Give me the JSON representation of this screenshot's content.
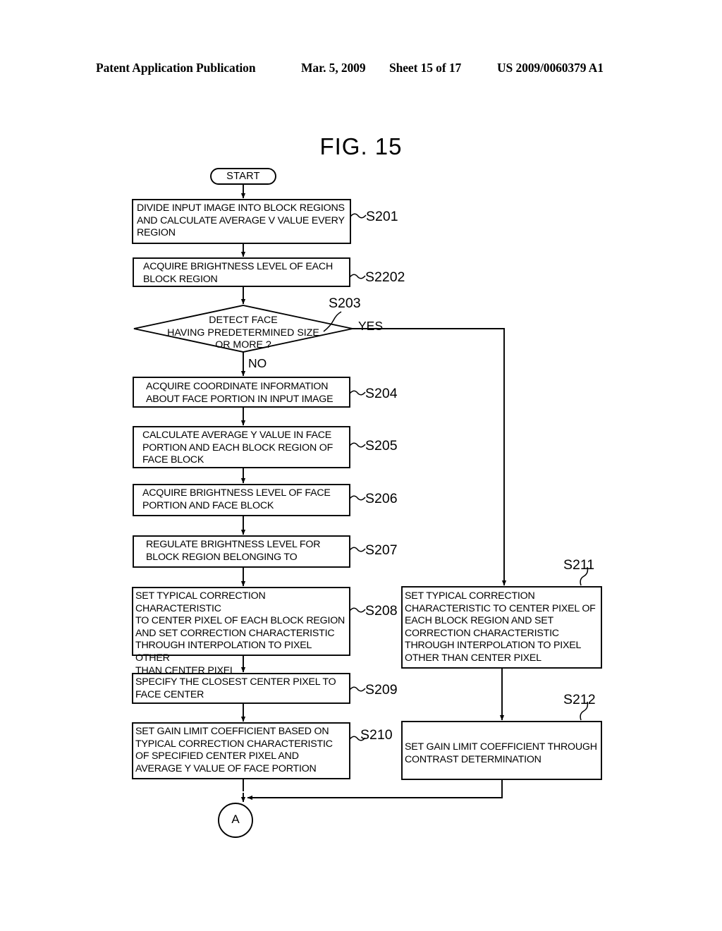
{
  "header": {
    "publication": "Patent Application Publication",
    "date": "Mar. 5, 2009",
    "sheet": "Sheet 15 of 17",
    "patent_number": "US 2009/0060379 A1"
  },
  "figure": {
    "title": "FIG. 15"
  },
  "flowchart": {
    "terminal_start": "START",
    "connector_a": "A",
    "branch_yes": "YES",
    "branch_no": "NO",
    "nodes": [
      {
        "id": "S201",
        "step": "S201",
        "text": "DIVIDE INPUT IMAGE INTO BLOCK REGIONS\nAND CALCULATE AVERAGE V VALUE EVERY\nREGION"
      },
      {
        "id": "S2202",
        "step": "S2202",
        "text": "ACQUIRE BRIGHTNESS LEVEL OF EACH\nBLOCK REGION"
      },
      {
        "id": "S203",
        "step": "S203",
        "text": "DETECT FACE\nHAVING PREDETERMINED SIZE\nOR MORE ?"
      },
      {
        "id": "S204",
        "step": "S204",
        "text": "ACQUIRE COORDINATE INFORMATION\nABOUT FACE PORTION IN INPUT IMAGE"
      },
      {
        "id": "S205",
        "step": "S205",
        "text": "CALCULATE AVERAGE Y VALUE IN FACE\nPORTION AND EACH BLOCK REGION OF\nFACE BLOCK"
      },
      {
        "id": "S206",
        "step": "S206",
        "text": "ACQUIRE BRIGHTNESS LEVEL OF FACE\nPORTION AND FACE BLOCK"
      },
      {
        "id": "S207",
        "step": "S207",
        "text": "REGULATE BRIGHTNESS LEVEL FOR\nBLOCK REGION BELONGING TO"
      },
      {
        "id": "S208",
        "step": "S208",
        "text": "SET TYPICAL CORRECTION CHARACTERISTIC\nTO CENTER PIXEL OF EACH BLOCK REGION\nAND SET CORRECTION CHARACTERISTIC\nTHROUGH INTERPOLATION TO PIXEL OTHER\nTHAN CENTER PIXEL"
      },
      {
        "id": "S209",
        "step": "S209",
        "text": "SPECIFY THE CLOSEST CENTER PIXEL TO\nFACE CENTER"
      },
      {
        "id": "S210",
        "step": "S210",
        "text": "SET GAIN LIMIT COEFFICIENT BASED ON\nTYPICAL CORRECTION CHARACTERISTIC\nOF SPECIFIED CENTER PIXEL AND\nAVERAGE Y VALUE OF FACE PORTION"
      },
      {
        "id": "S211",
        "step": "S211",
        "text": "SET TYPICAL CORRECTION\nCHARACTERISTIC TO CENTER PIXEL OF\nEACH BLOCK REGION AND SET\nCORRECTION CHARACTERISTIC\nTHROUGH INTERPOLATION TO PIXEL\nOTHER THAN CENTER PIXEL"
      },
      {
        "id": "S212",
        "step": "S212",
        "text": "SET GAIN LIMIT COEFFICIENT THROUGH\nCONTRAST DETERMINATION"
      }
    ]
  },
  "colors": {
    "ink": "#000000",
    "paper": "#ffffff"
  }
}
